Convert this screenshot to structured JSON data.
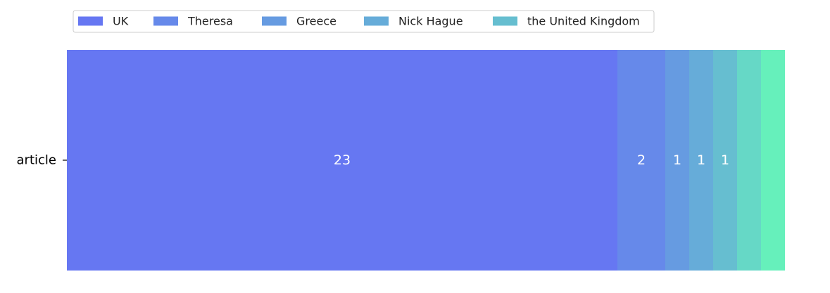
{
  "chart_data": {
    "type": "bar",
    "orientation": "horizontal",
    "stacked": true,
    "categories": [
      "article"
    ],
    "series": [
      {
        "name": "UK",
        "values": [
          23
        ],
        "color": "#6677f2",
        "label": "23"
      },
      {
        "name": "Theresa",
        "values": [
          2
        ],
        "color": "#6689ea",
        "label": "2"
      },
      {
        "name": "Greece",
        "values": [
          1
        ],
        "color": "#669be1",
        "label": "1"
      },
      {
        "name": "Nick Hague",
        "values": [
          1
        ],
        "color": "#66acd9",
        "label": "1"
      },
      {
        "name": "the United Kingdom",
        "values": [
          1
        ],
        "color": "#66bed0",
        "label": "1"
      },
      {
        "name": "",
        "values": [
          1
        ],
        "color": "#66d8c6",
        "label": ""
      },
      {
        "name": "",
        "values": [
          1
        ],
        "color": "#66f0bb",
        "label": ""
      }
    ],
    "xlim": [
      0,
      30
    ],
    "legend": {
      "placement": "top-left",
      "entries": [
        "UK",
        "Theresa",
        "Greece",
        "Nick Hague",
        "the United Kingdom"
      ]
    },
    "grid": false,
    "xaxis_visible": false,
    "title": "",
    "xlabel": "",
    "ylabel": ""
  }
}
